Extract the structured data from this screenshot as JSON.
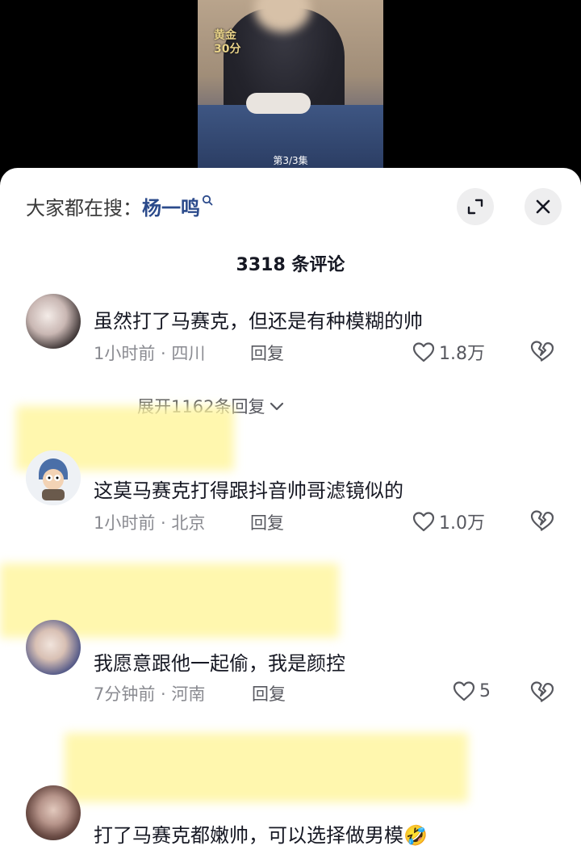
{
  "video": {
    "badge_line1": "黄金",
    "badge_line2": "30分",
    "episode": "第3/3集"
  },
  "sheet": {
    "search_prefix": "大家都在搜：",
    "search_keyword": "杨一鸣",
    "comment_count": "3318 条评论"
  },
  "comments": [
    {
      "username": "",
      "text": "虽然打了马赛克，但还是有种模糊的帅",
      "meta": "1小时前 · 四川",
      "reply_label": "回复",
      "likes": "1.8万",
      "expand_label": "展开1162条回复"
    },
    {
      "username": "",
      "text": "这莫马赛克打得跟抖音帅哥滤镜似的",
      "meta": "1小时前 · 北京",
      "reply_label": "回复",
      "likes": "1.0万"
    },
    {
      "username": "",
      "text": "我愿意跟他一起偷，我是颜控",
      "meta": "7分钟前 · 河南",
      "reply_label": "回复",
      "likes": "5"
    },
    {
      "username": "",
      "text": "打了马赛克都嫩帅，可以选择做男模🤣"
    }
  ],
  "colors": {
    "keyword": "#2b4a8b",
    "highlight": "#fff6a0",
    "meta": "#8a8b91"
  },
  "icons": [
    "search-icon",
    "expand-icon",
    "close-icon",
    "heart-icon",
    "broken-heart-icon",
    "chevron-down-icon"
  ]
}
